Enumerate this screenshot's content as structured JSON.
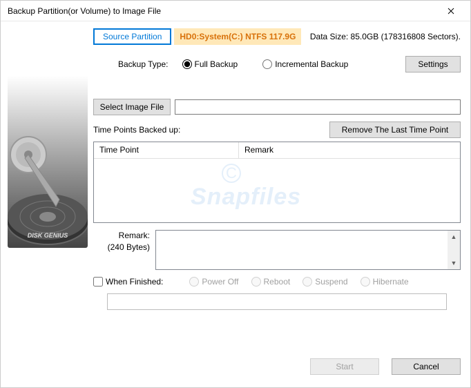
{
  "title": "Backup Partition(or Volume) to Image File",
  "tabs": {
    "source": "Source Partition"
  },
  "partition": "HD0:System(C:) NTFS 117.9G",
  "dataSize": "Data Size: 85.0GB (178316808 Sectors).",
  "backupTypeLabel": "Backup Type:",
  "backupTypes": {
    "full": "Full Backup",
    "incremental": "Incremental Backup"
  },
  "settings": "Settings",
  "selectImage": "Select Image File",
  "imagePath": "",
  "timePointsLabel": "Time Points Backed up:",
  "removeLast": "Remove The Last Time Point",
  "table": {
    "col1": "Time Point",
    "col2": "Remark"
  },
  "remarkLabel": "Remark:",
  "remarkBytes": "(240 Bytes)",
  "remarkText": "",
  "whenFinished": "When Finished:",
  "finish": {
    "poweroff": "Power Off",
    "reboot": "Reboot",
    "suspend": "Suspend",
    "hibernate": "Hibernate"
  },
  "start": "Start",
  "cancel": "Cancel",
  "watermark": "Snapfiles"
}
